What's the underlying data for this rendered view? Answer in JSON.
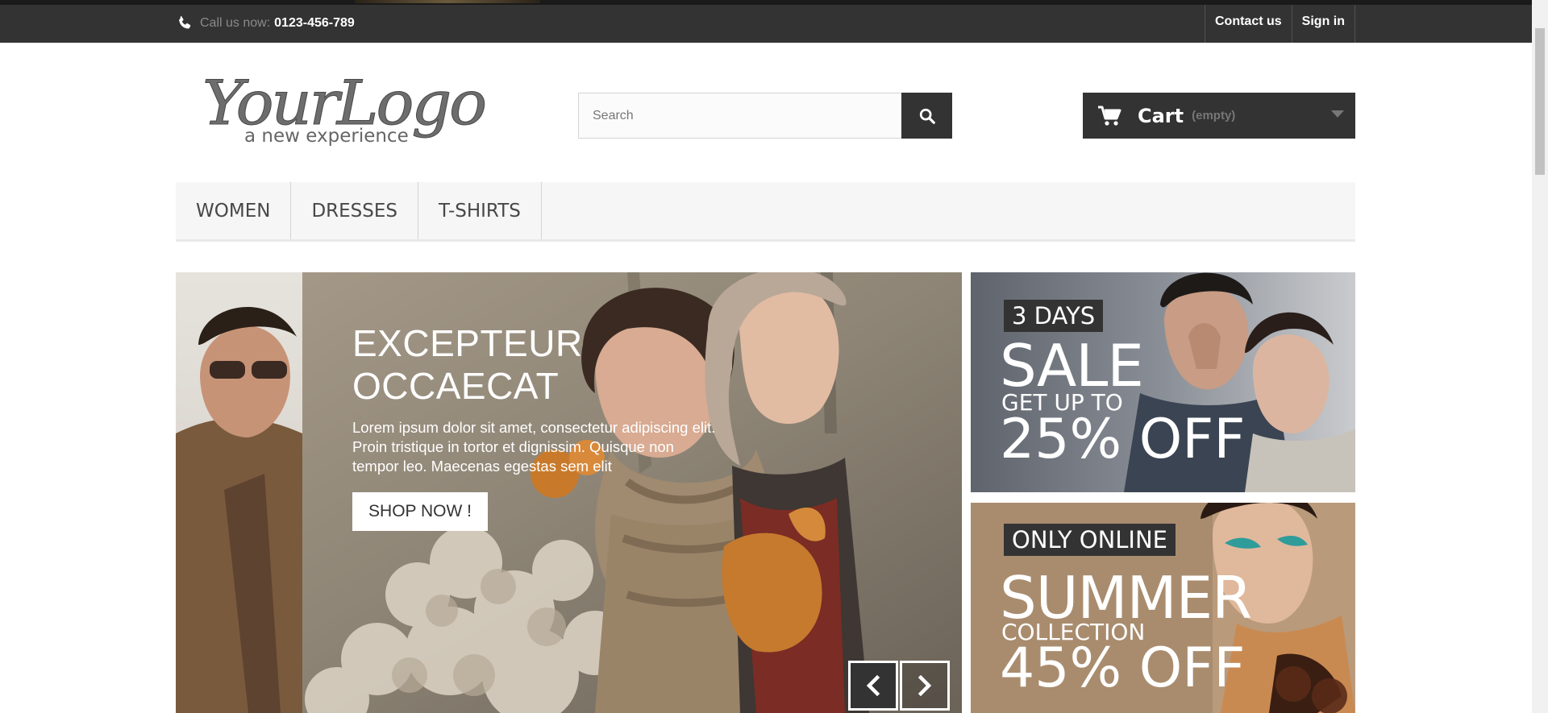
{
  "topbar": {
    "call_label": "Call us now:",
    "phone": "0123-456-789",
    "contact_label": "Contact us",
    "signin_label": "Sign in"
  },
  "logo": {
    "script_text": "YourLogo",
    "tagline": "a new experience"
  },
  "search": {
    "placeholder": "Search"
  },
  "cart": {
    "label": "Cart",
    "status": "(empty)"
  },
  "menu": {
    "items": [
      {
        "label": "WOMEN"
      },
      {
        "label": "DRESSES"
      },
      {
        "label": "T-SHIRTS"
      }
    ]
  },
  "slider": {
    "title": "EXCEPTEUR OCCAECAT",
    "body": "Lorem ipsum dolor sit amet, consectetur adipiscing elit. Proin tristique in tortor et dignissim. Quisque non tempor leo. Maecenas egestas sem elit",
    "button": "SHOP NOW !"
  },
  "banners": [
    {
      "tag": "3 DAYS",
      "headline": "SALE",
      "sub": "GET UP TO",
      "offer": "25% OFF"
    },
    {
      "tag": "ONLY ONLINE",
      "headline": "SUMMER",
      "sub": "COLLECTION",
      "offer": "45% OFF"
    }
  ],
  "colors": {
    "dark": "#333333",
    "menu_bg": "#f6f6f6",
    "border": "#d6d4d4"
  },
  "icons": {
    "phone": "phone-icon",
    "search": "search-icon",
    "cart": "cart-icon",
    "prev": "chevron-left-icon",
    "next": "chevron-right-icon"
  }
}
